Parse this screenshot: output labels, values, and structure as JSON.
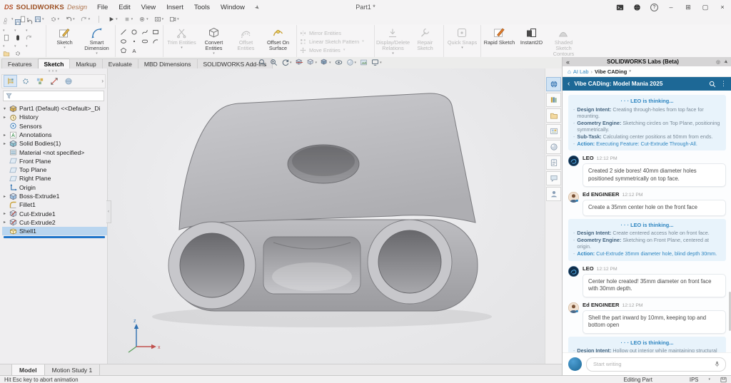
{
  "window": {
    "brand_mark": "DS",
    "brand_name": "SOLIDWORKS",
    "brand_suffix": "Design",
    "menus": [
      "File",
      "Edit",
      "View",
      "Insert",
      "Tools",
      "Window"
    ],
    "title": "Part1 *",
    "controls": [
      "console-icon",
      "globe-icon",
      "help-icon",
      "minimize-icon",
      "layout-icon",
      "restore-icon",
      "close-icon"
    ]
  },
  "quick_access": {
    "icons": [
      "home",
      "new-document",
      "save",
      "settings",
      "undo",
      "redo",
      "sep",
      "play",
      "stop",
      "record",
      "capture",
      "video-settings"
    ]
  },
  "ribbon": {
    "left_icons": [
      [
        "home",
        "save",
        "undo"
      ],
      [
        "new-document",
        "pill",
        "redo"
      ],
      [
        "open",
        "settings"
      ]
    ],
    "groups": [
      {
        "type": "big",
        "items": [
          {
            "label": "Sketch",
            "icon": "sketch",
            "enabled": true,
            "caret": true
          },
          {
            "label": "Smart Dimension",
            "icon": "smart-dimension",
            "enabled": true,
            "caret": true
          }
        ]
      },
      {
        "type": "grid",
        "icons": [
          "line",
          "circle",
          "spline",
          "rect",
          "ellipse",
          "point",
          "slot",
          "arc",
          "poly",
          "textA"
        ]
      },
      {
        "type": "big",
        "items": [
          {
            "label": "Trim Entities",
            "icon": "trim",
            "enabled": false,
            "caret": true
          },
          {
            "label": "Convert Entities",
            "icon": "convert",
            "enabled": true,
            "caret": true
          },
          {
            "label": "Offset Entities",
            "icon": "offset",
            "enabled": false,
            "caret": false
          },
          {
            "label": "Offset On Surface",
            "icon": "offset-surface",
            "enabled": true,
            "caret": false
          }
        ]
      },
      {
        "type": "stack",
        "items": [
          {
            "label": "Mirror Entities",
            "icon": "mirror",
            "enabled": false,
            "caret": false
          },
          {
            "label": "Linear Sketch Pattern",
            "icon": "pattern",
            "enabled": false,
            "caret": true
          },
          {
            "label": "Move Entities",
            "icon": "move",
            "enabled": false,
            "caret": true
          }
        ]
      },
      {
        "type": "big",
        "items": [
          {
            "label": "Display/Delete Relations",
            "icon": "relations",
            "enabled": false,
            "caret": true
          },
          {
            "label": "Repair Sketch",
            "icon": "repair",
            "enabled": false,
            "caret": false
          }
        ]
      },
      {
        "type": "big",
        "items": [
          {
            "label": "Quick Snaps",
            "icon": "snaps",
            "enabled": false,
            "caret": true
          }
        ]
      },
      {
        "type": "big",
        "items": [
          {
            "label": "Rapid Sketch",
            "icon": "rapid",
            "enabled": true,
            "caret": false
          },
          {
            "label": "Instant2D",
            "icon": "instant2d",
            "enabled": true,
            "caret": false
          },
          {
            "label": "Shaded Sketch Contours",
            "icon": "shaded",
            "enabled": false,
            "caret": false
          }
        ]
      }
    ]
  },
  "doc_tabs": {
    "items": [
      "Features",
      "Sketch",
      "Markup",
      "Evaluate",
      "MBD Dimensions",
      "SOLIDWORKS Add-Ins"
    ],
    "active": "Sketch"
  },
  "headsup_icons": [
    "zoom-fit",
    "zoom-area",
    "previous-view",
    "section-view",
    "view-orientation",
    "display-style",
    "hide-show-items",
    "edit-appearance",
    "apply-scene",
    "view-settings"
  ],
  "feature_tree": {
    "tab_icons": [
      "featuremanager",
      "propertymanager",
      "configurationmanager",
      "dimxpertmanager",
      "displaymanager"
    ],
    "root": "Part1 (Default) <<Default>_Di",
    "items": [
      {
        "label": "History",
        "icon": "history",
        "arrow": true
      },
      {
        "label": "Sensors",
        "icon": "sensors",
        "arrow": false
      },
      {
        "label": "Annotations",
        "icon": "annotations",
        "arrow": true
      },
      {
        "label": "Solid Bodies(1)",
        "icon": "solid-bodies",
        "arrow": true
      },
      {
        "label": "Material <not specified>",
        "icon": "material",
        "arrow": false
      },
      {
        "label": "Front Plane",
        "icon": "plane",
        "arrow": false
      },
      {
        "label": "Top Plane",
        "icon": "plane",
        "arrow": false
      },
      {
        "label": "Right Plane",
        "icon": "plane",
        "arrow": false
      },
      {
        "label": "Origin",
        "icon": "origin",
        "arrow": false
      },
      {
        "label": "Boss-Extrude1",
        "icon": "boss-extrude",
        "arrow": true
      },
      {
        "label": "Fillet1",
        "icon": "fillet",
        "arrow": false
      },
      {
        "label": "Cut-Extrude1",
        "icon": "cut-extrude",
        "arrow": true
      },
      {
        "label": "Cut-Extrude2",
        "icon": "cut-extrude",
        "arrow": true
      },
      {
        "label": "Shell1",
        "icon": "shell",
        "arrow": false,
        "selected": true
      }
    ]
  },
  "taskpane_icons": [
    "threedexperience",
    "design-library",
    "file-explorer",
    "view-palette",
    "appearances",
    "custom-properties",
    "forum",
    "user-profile"
  ],
  "chat": {
    "panel_title": "SOLIDWORKS Labs (Beta)",
    "breadcrumb": {
      "home": "AI Lab",
      "current": "Vibe CADing"
    },
    "title": "Vibe CADing: Model Mania 2025",
    "thinking_label": "LEO is thinking...",
    "thinking_dots": "· · ·",
    "messages": [
      {
        "type": "thinking",
        "bullets": [
          {
            "label": "Design Intent:",
            "text": "Creating through-holes from top face for mounting.",
            "accent": false
          },
          {
            "label": "Geometry Engine:",
            "text": "Sketching circles on Top Plane, positioning symmetrically.",
            "accent": false
          },
          {
            "label": "Sub-Task:",
            "text": "Calculating center positions at 50mm from ends.",
            "accent": false
          },
          {
            "label": "Action:",
            "text": "Executing Feature: Cut-Extrude Through-All.",
            "accent": true
          }
        ]
      },
      {
        "type": "message",
        "author": "LEO",
        "time": "12:12 PM",
        "avatar": "leo",
        "text": "Created 2 side bores! 40mm diameter holes positioned symmetrically on top face."
      },
      {
        "type": "message",
        "author": "Ed ENGINEER",
        "time": "12:12 PM",
        "avatar": "ed",
        "text": "Create a 35mm center hole on the front face"
      },
      {
        "type": "thinking",
        "bullets": [
          {
            "label": "Design Intent:",
            "text": "Create centered access hole on front face.",
            "accent": false
          },
          {
            "label": "Geometry Engine:",
            "text": "Sketching on Front Plane, centered at origin.",
            "accent": false
          },
          {
            "label": "Action:",
            "text": "Cut-Extrude 35mm diameter hole, blind depth 30mm.",
            "accent": true
          }
        ]
      },
      {
        "type": "message",
        "author": "LEO",
        "time": "12:12 PM",
        "avatar": "leo",
        "text": "Center hole created! 35mm diameter on front face with 30mm depth."
      },
      {
        "type": "message",
        "author": "Ed ENGINEER",
        "time": "12:12 PM",
        "avatar": "ed",
        "text": "Shell the part inward by 10mm, keeping top and bottom open"
      },
      {
        "type": "thinking",
        "bullets": [
          {
            "label": "Design Intent:",
            "text": "Hollow out interior while maintaining structural faces.",
            "accent": false
          }
        ]
      }
    ],
    "input_placeholder": "Start writing"
  },
  "bottom_tabs": {
    "items": [
      "Model",
      "Motion Study 1"
    ],
    "active": "Model"
  },
  "status_bar": {
    "left": "Hit Esc key to abort animation",
    "mode": "Editing Part",
    "units": "IPS"
  },
  "colors": {
    "accent_blue": "#1d6896",
    "thinking_bg": "#e8f3fb",
    "thinking_text": "#2f86c1",
    "selection": "#b9d5ef",
    "rollback": "#1f74c9"
  }
}
